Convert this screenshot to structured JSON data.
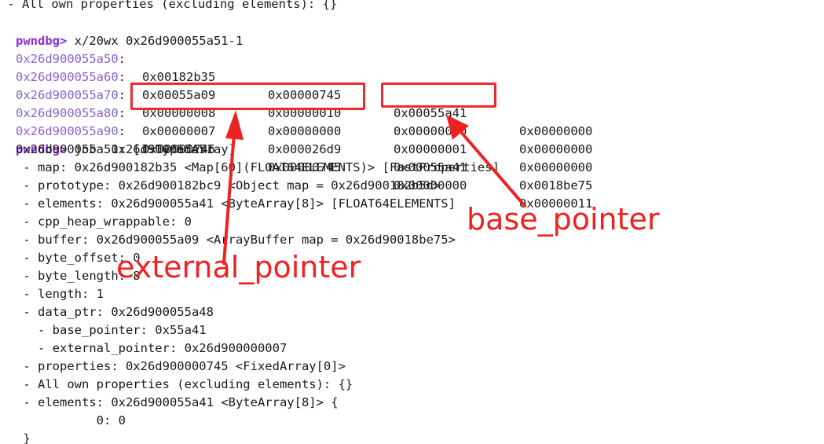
{
  "terminal": {
    "top_line": " - All own properties (excluding elements): {}",
    "prompt_1": "pwndbg>",
    "command_1": " x/20wx 0x26d900055a51-1",
    "memory_rows": [
      {
        "address": "0x26d900055a50",
        "sep": ":",
        "words": [
          "0x00182b35",
          "0x00000745",
          "0x00055a41",
          "0x00000000"
        ]
      },
      {
        "address": "0x26d900055a60",
        "sep": ":",
        "words": [
          "0x00055a09",
          "0x00000010",
          "0x00000000",
          "0x00000000"
        ]
      },
      {
        "address": "0x26d900055a70",
        "sep": ":",
        "words": [
          "0x00000008",
          "0x00000000",
          "0x00000001",
          "0x00000000"
        ]
      },
      {
        "address": "0x26d900055a80",
        "sep": ":",
        "words": [
          "0x00000007",
          "0x000026d9",
          "0x00055a41",
          "0x0018be75"
        ]
      },
      {
        "address": "0x26d900055a90",
        "sep": ":",
        "words": [
          "0x00000745",
          "0x00000745",
          "0x00000000",
          "0x00000011"
        ]
      }
    ],
    "prompt_2": "pwndbg>",
    "command_2": " job  0x26d900055a51",
    "output_lines": [
      "0x26d900055a51: [JSTypedArray]",
      " - map: 0x26d900182b35 <Map[60](FLOAT64ELEMENTS)> [FastProperties]",
      " - prototype: 0x26d900182bc9 <Object map = 0x26d900182b5d>",
      " - elements: 0x26d900055a41 <ByteArray[8]> [FLOAT64ELEMENTS]",
      " - cpp_heap_wrappable: 0",
      " - buffer: 0x26d900055a09 <ArrayBuffer map = 0x26d90018be75>",
      " - byte_offset: 0",
      " - byte_length: 8",
      " - length: 1",
      " - data_ptr: 0x26d900055a48",
      "   - base_pointer: 0x55a41",
      "   - external_pointer: 0x26d900000007",
      " - properties: 0x26d900000745 <FixedArray[0]>",
      " - All own properties (excluding elements): {}",
      " - elements: 0x26d900055a41 <ByteArray[8]> {",
      "           0: 0",
      " }"
    ]
  },
  "annotations": {
    "base_pointer_label": "base_pointer",
    "external_pointer_label": "external_pointer",
    "color": "#ee2222"
  }
}
